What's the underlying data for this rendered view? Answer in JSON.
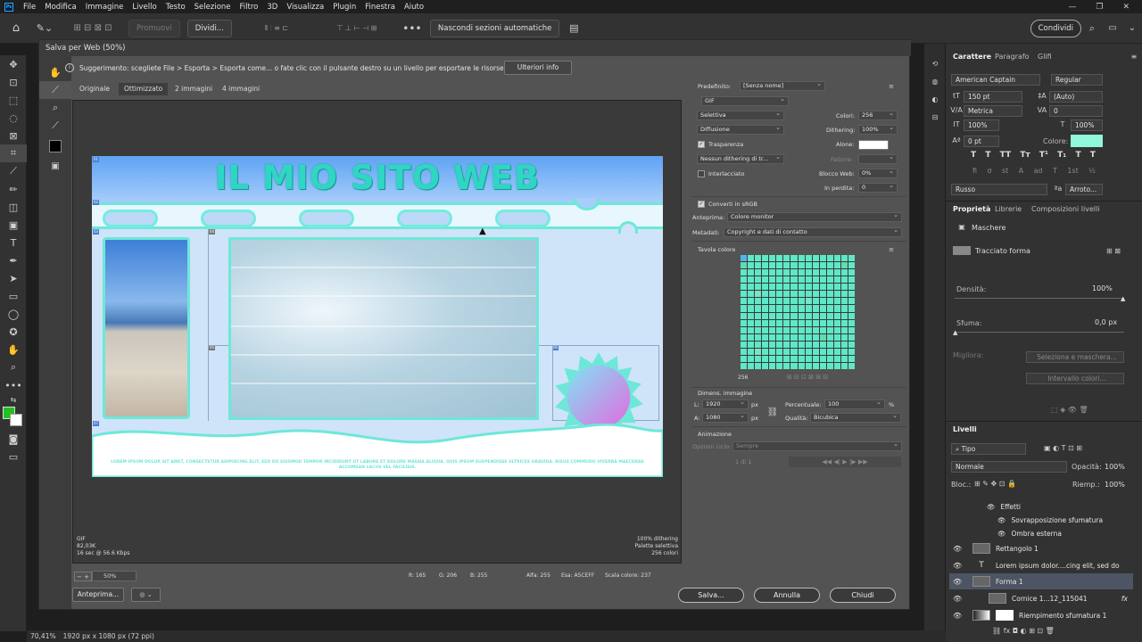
{
  "menu": {
    "app_logo": "Ps",
    "items": [
      "File",
      "Modifica",
      "Immagine",
      "Livello",
      "Testo",
      "Selezione",
      "Filtro",
      "3D",
      "Visualizza",
      "Plugin",
      "Finestra",
      "Aiuto"
    ],
    "window_buttons": [
      "—",
      "❐",
      "✕"
    ]
  },
  "options_bar": {
    "promuovi": "Promuovi",
    "dividi": "Dividi...",
    "nascondi": "Nascondi sezioni automatiche",
    "share": "Condividi"
  },
  "dialog": {
    "title": "Salva per Web (50%)",
    "hint": "Suggerimento: scegliete File > Esporta > Esporta come... o fate clic con il pulsante destro su un livello per esportare le risorse più velocemente",
    "hint_button": "Ulteriori info",
    "tabs": [
      "Originale",
      "Ottimizzato",
      "2 immagini",
      "4 immagini"
    ],
    "active_tab": "Ottimizzato",
    "site": {
      "title": "IL MIO SITO WEB",
      "footer_text": "LOREM IPSUM DOLOR SIT AMET, CONSECTETUR ADIPISCING ELIT, SED DO EIUSMOD TEMPOR INCIDIDUNT UT LABORE ET DOLORE MAGNA ALIQUA. QUIS IPSUM SUSPENDISSE ULTRICES GRAVIDA. RISUS COMMODO VIVERRA MAECENAS ACCUMSAN LACUS VEL FACILISIS.",
      "slice_labels": [
        "01",
        "02",
        "03",
        "04",
        "05",
        "06",
        "07",
        "08"
      ]
    },
    "preview_status_left": [
      "GIF",
      "82,03K",
      "16 sec @ 56.6 Kbps"
    ],
    "preview_status_right": [
      "100% dithering",
      "Palette selettiva",
      "256 colori"
    ],
    "zoom": "50%",
    "readouts": {
      "r": "R: 165",
      "g": "G: 206",
      "b": "B: 255",
      "alpha": "Alfa: 255",
      "hex": "Esa: A5CEFF",
      "index": "Scala colore: 237"
    },
    "buttons": {
      "anteprima": "Anteprima...",
      "save": "Salva...",
      "cancel": "Annulla",
      "done": "Chiudi"
    },
    "settings": {
      "preset_label": "Predefinito:",
      "preset_value": "[Senza nome]",
      "format": "GIF",
      "reduction": "Selettiva",
      "dither_algo": "Diffusione",
      "colors_label": "Colori:",
      "colors_value": "256",
      "dithering_label": "Dithering:",
      "dithering_value": "100%",
      "transparency": "Trasparenza",
      "matte_label": "Alone:",
      "trans_dither": "Nessun dithering di tr...",
      "amount_label": "Fattore:",
      "interlaced": "Interlacciato",
      "websnap_label": "Blocco Web:",
      "websnap_value": "0%",
      "lossy_label": "In perdita:",
      "lossy_value": "0",
      "convert_srgb": "Converti in sRGB",
      "preview_label": "Anteprima:",
      "preview_value": "Colore monitor",
      "metadata_label": "Metadati:",
      "metadata_value": "Copyright e dati di contatto",
      "color_table": "Tavola colore",
      "palette_count": "256",
      "image_size": "Dimens. immagine",
      "w_label": "L:",
      "w_value": "1920",
      "h_label": "A:",
      "h_value": "1080",
      "unit": "px",
      "percent_label": "Percentuale:",
      "percent_value": "100",
      "percent_unit": "%",
      "quality_label": "Qualità:",
      "quality_value": "Bicubica",
      "animation": "Animazione",
      "loop_label": "Opzioni ciclo:",
      "loop_value": "Sempre",
      "frame": "1 di 1"
    }
  },
  "right_panel": {
    "char_tabs": [
      "Carattere",
      "Paragrafo",
      "Glifi"
    ],
    "font_family": "American Captain",
    "font_style": "Regular",
    "font_size": "150 pt",
    "leading": "(Auto)",
    "kerning": "Metrica",
    "tracking": "0",
    "vscale": "100%",
    "hscale": "100%",
    "baseline": "0 pt",
    "color_label": "Colore:",
    "language": "Russo",
    "aa": "Arroto...",
    "type_buttons": [
      "T",
      "T",
      "TT",
      "Tт",
      "T¹",
      "T₁",
      "T",
      "T"
    ],
    "opentype_buttons": [
      "fi",
      "σ",
      "st",
      "A",
      "ad",
      "T",
      "1st",
      "½"
    ],
    "prop_tabs": [
      "Proprietà",
      "Librerie",
      "Composizioni livelli"
    ],
    "masks": "Maschere",
    "vector_mask": "Tracciato forma",
    "density_label": "Densità:",
    "density_value": "100%",
    "feather_label": "Sfuma:",
    "feather_value": "0,0 px",
    "refine_label": "Migliora:",
    "select_mask": "Seleziona e maschera...",
    "color_range": "Intervallo colori...",
    "layers_tab": "Livelli",
    "filter_kind": "Tipo",
    "blend_mode": "Normale",
    "opacity_label": "Opacità:",
    "opacity_value": "100%",
    "lock_label": "Bloc.:",
    "fill_label": "Riemp.:",
    "fill_value": "100%",
    "layers": [
      {
        "name": "Effetti",
        "indent": 2,
        "type": "fx"
      },
      {
        "name": "Sovrapposizione sfumatura",
        "indent": 3,
        "type": "effect"
      },
      {
        "name": "Ombra esterna",
        "indent": 3,
        "type": "effect"
      },
      {
        "name": "Rettangolo 1",
        "indent": 0,
        "type": "shape"
      },
      {
        "name": "Lorem ipsum dolor....cing elit, sed do",
        "indent": 0,
        "type": "text"
      },
      {
        "name": "Forma 1",
        "indent": 0,
        "type": "shape"
      },
      {
        "name": "Cornice 1...12_115041",
        "indent": 1,
        "type": "frame"
      },
      {
        "name": "Riempimento sfumatura 1",
        "indent": 0,
        "type": "fill"
      }
    ],
    "selected_layer": "Forma 1"
  },
  "status": {
    "zoom": "70,41%",
    "size": "1920 px x 1080 px (72 ppi)"
  },
  "colors": {
    "accent_cyan": "#6de8d8",
    "site_sky": "#5fa3f3",
    "char_color": "#8ff7da"
  }
}
